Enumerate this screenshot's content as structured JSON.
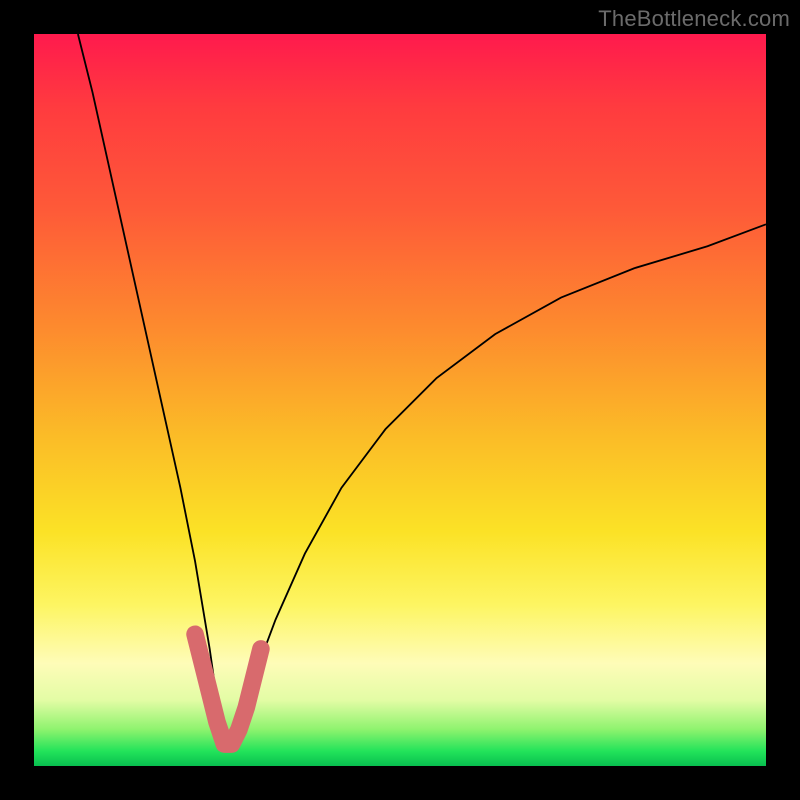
{
  "watermark": "TheBottleneck.com",
  "colors": {
    "frame": "#000000",
    "curve": "#000000",
    "accent_band": "#d86a6d",
    "gradient_top": "#ff1a4d",
    "gradient_mid": "#fbbc27",
    "gradient_bottom": "#08bf4f"
  },
  "chart_data": {
    "type": "line",
    "title": "",
    "xlabel": "",
    "ylabel": "",
    "xlim": [
      0,
      100
    ],
    "ylim": [
      0,
      100
    ],
    "grid": false,
    "legend": false,
    "note": "Axes are unlabeled; values are read as percentage of plot width/height. 0 = bottom/left, 100 = top/right. The curve depicts a steep V-shaped dip with its minimum near x≈26, y≈3. The pink accent band traces the region near the minimum (the bottom of the V).",
    "series": [
      {
        "name": "bottleneck-curve",
        "color": "#000000",
        "x": [
          6,
          8,
          10,
          12,
          14,
          16,
          18,
          20,
          22,
          24,
          25,
          26,
          27,
          28,
          30,
          33,
          37,
          42,
          48,
          55,
          63,
          72,
          82,
          92,
          100
        ],
        "y": [
          100,
          92,
          83,
          74,
          65,
          56,
          47,
          38,
          28,
          16,
          9,
          3,
          3,
          6,
          12,
          20,
          29,
          38,
          46,
          53,
          59,
          64,
          68,
          71,
          74
        ]
      },
      {
        "name": "accent-band",
        "color": "#d86a6d",
        "x": [
          22,
          23,
          24,
          25,
          26,
          27,
          28,
          29,
          30,
          31
        ],
        "y": [
          18,
          14,
          10,
          6,
          3,
          3,
          5,
          8,
          12,
          16
        ]
      }
    ]
  }
}
